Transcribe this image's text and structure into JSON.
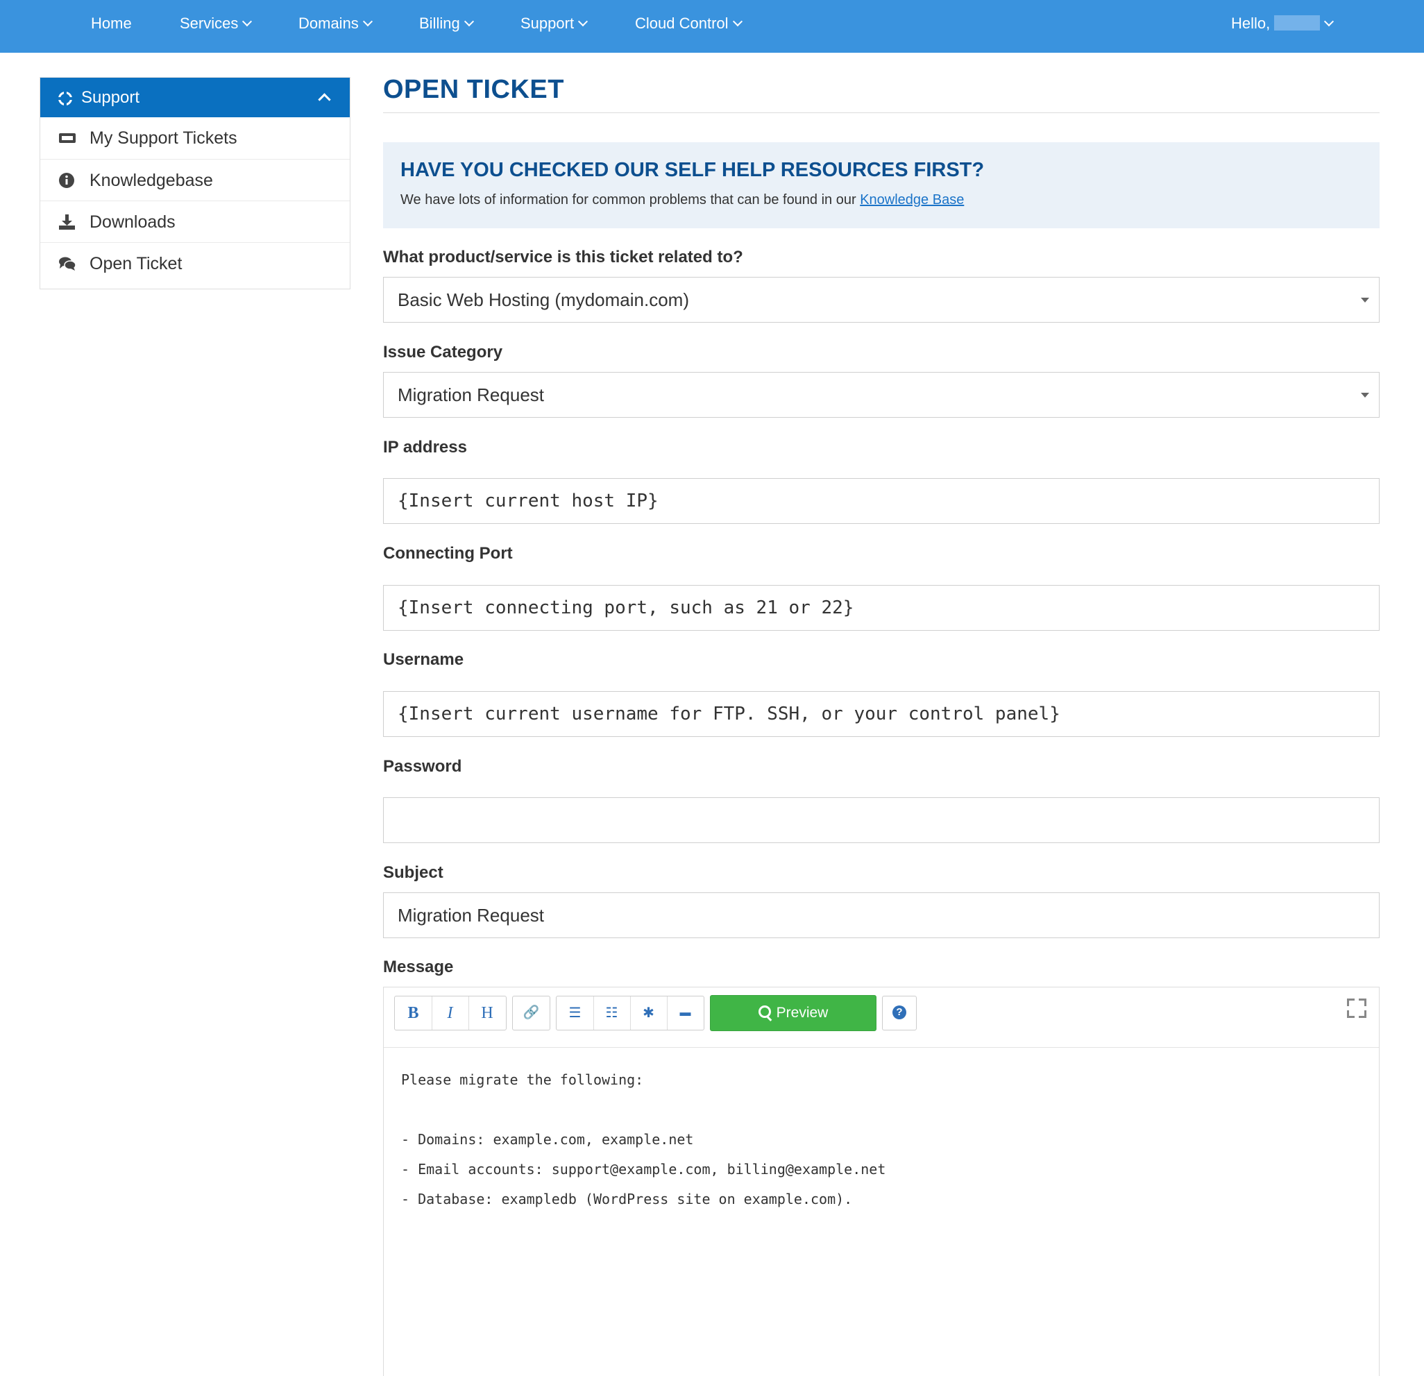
{
  "nav": {
    "items": [
      {
        "label": "Home",
        "dropdown": false
      },
      {
        "label": "Services",
        "dropdown": true
      },
      {
        "label": "Domains",
        "dropdown": true
      },
      {
        "label": "Billing",
        "dropdown": true
      },
      {
        "label": "Support",
        "dropdown": true
      },
      {
        "label": "Cloud Control",
        "dropdown": true
      }
    ],
    "greeting": "Hello,"
  },
  "sidebar": {
    "header": "Support",
    "header_icon": "life-ring-icon",
    "items": [
      {
        "label": "My Support Tickets",
        "icon": "ticket-icon"
      },
      {
        "label": "Knowledgebase",
        "icon": "info-circle-icon"
      },
      {
        "label": "Downloads",
        "icon": "download-icon"
      },
      {
        "label": "Open Ticket",
        "icon": "comments-icon"
      }
    ]
  },
  "main": {
    "title": "OPEN TICKET",
    "help": {
      "title": "HAVE YOU CHECKED OUR SELF HELP RESOURCES FIRST?",
      "text": "We have lots of information for common problems that can be found in our",
      "link": "Knowledge Base"
    },
    "fields": {
      "product": {
        "label": "What product/service is this ticket related to?",
        "value": "Basic Web Hosting (mydomain.com)"
      },
      "category": {
        "label": "Issue Category",
        "value": "Migration Request"
      },
      "ip": {
        "label": "IP address",
        "value": "{Insert current host IP}"
      },
      "port": {
        "label": "Connecting Port",
        "value": "{Insert connecting port, such as 21 or 22}"
      },
      "username": {
        "label": "Username",
        "value": "{Insert current username for FTP. SSH, or your control panel}"
      },
      "password": {
        "label": "Password",
        "value": ""
      },
      "subject": {
        "label": "Subject",
        "value": "Migration Request"
      },
      "message": {
        "label": "Message"
      }
    },
    "editor": {
      "toolbar": {
        "bold": "B",
        "italic": "I",
        "heading": "H",
        "link": "🔗",
        "ul": "☰",
        "ol": "☷",
        "image": "✱",
        "quote": "▬",
        "preview": "Preview",
        "help": "?"
      },
      "lines": [
        "Please migrate the following:",
        "",
        "- Domains: example.com, example.net",
        "- Email accounts: support@example.com, billing@example.net",
        "- Database: exampledb (WordPress site on example.com)."
      ]
    }
  },
  "colors": {
    "nav_bg": "#3a93de",
    "sidebar_active": "#0a70c0",
    "title": "#0d4f8f",
    "preview_green": "#40b546",
    "help_bg": "#eaf1f8"
  }
}
